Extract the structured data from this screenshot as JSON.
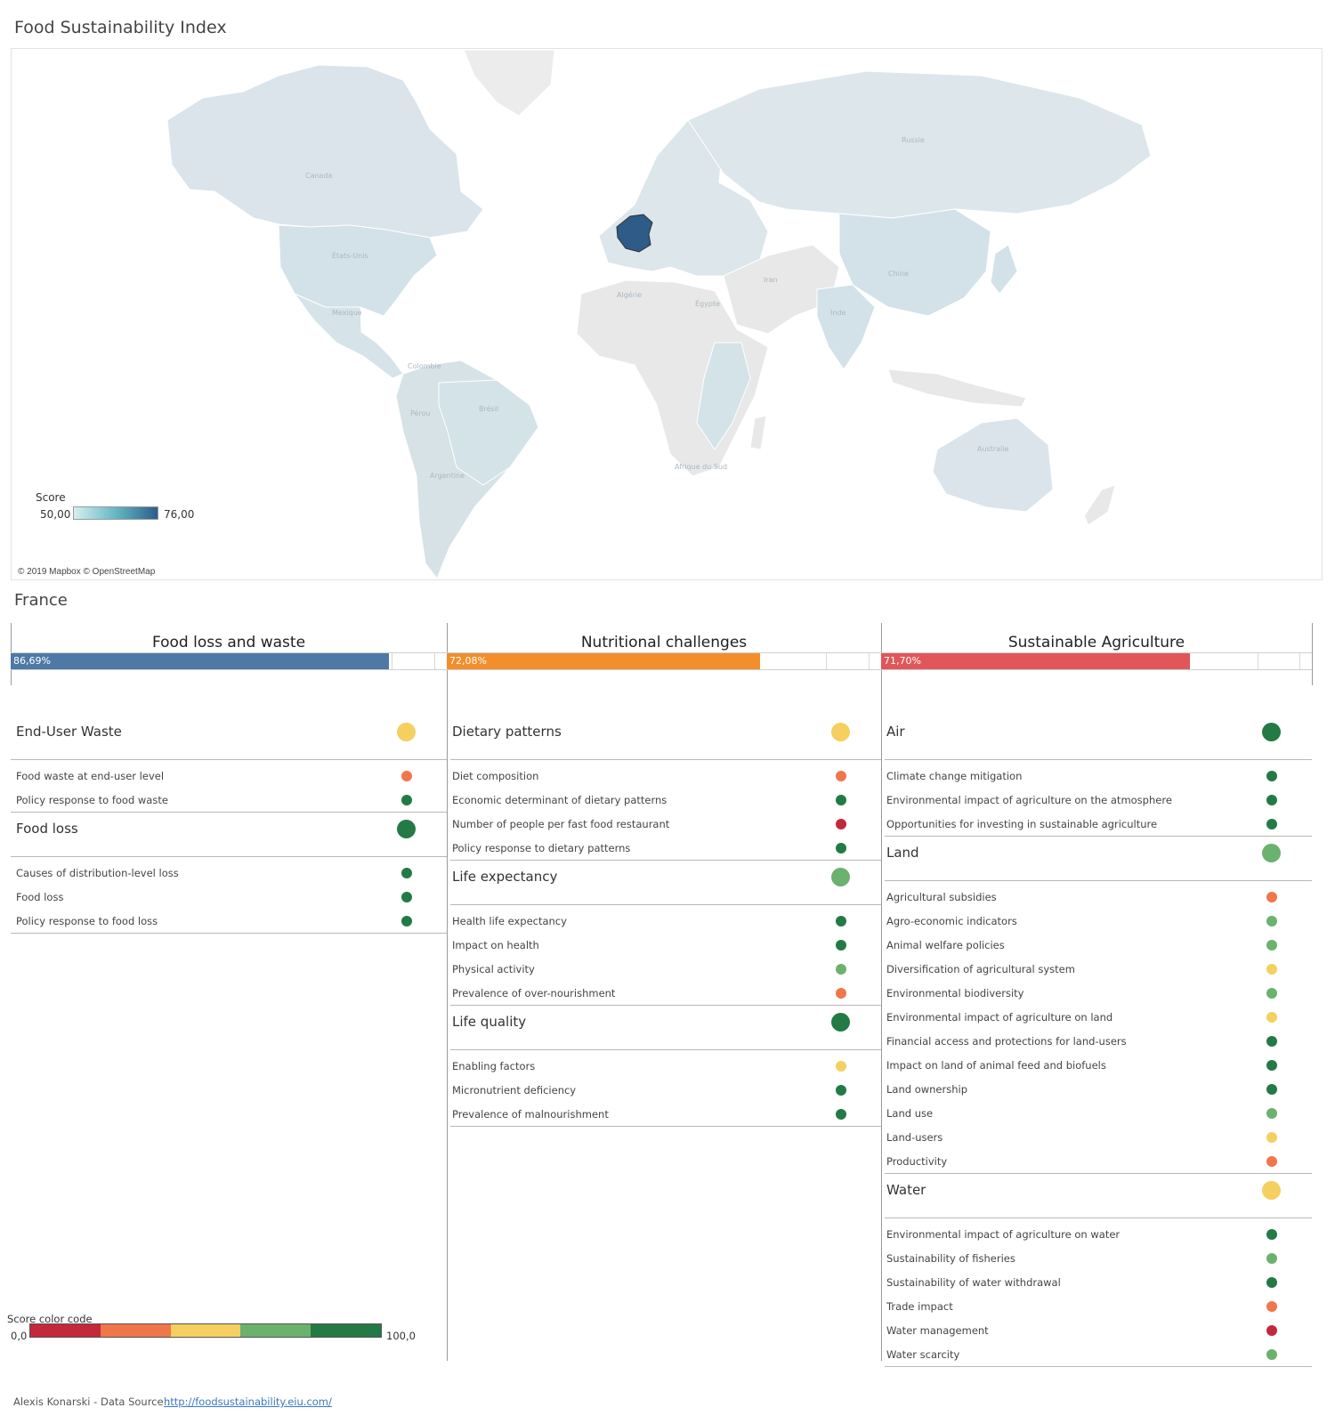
{
  "page": {
    "title": "Food Sustainability Index",
    "country": "France"
  },
  "map": {
    "legend": {
      "title": "Score",
      "min": "50,00",
      "max": "76,00"
    },
    "labels": {
      "canada": "Canada",
      "usa": "États-Unis",
      "mexico": "Mexique",
      "colombia": "Colombie",
      "peru": "Pérou",
      "brazil": "Brésil",
      "argentina": "Argentine",
      "algeria": "Algérie",
      "egypt": "Égypte",
      "south_africa": "Afrique du Sud",
      "russia": "Russie",
      "iran": "Iran",
      "china": "Chine",
      "india": "Inde",
      "australia": "Australie"
    },
    "credit": "© 2019 Mapbox © OpenStreetMap",
    "colors": {
      "highlight": "#2e5b87",
      "high_score": "#d3e3e8",
      "low_score": "#e0e6ea",
      "no_data": "#ececec"
    }
  },
  "score_colors": {
    "very_low": "#c4283b",
    "low": "#f0774a",
    "medium": "#f5cf60",
    "high": "#6ab26d",
    "very_high": "#237a44"
  },
  "pillars": [
    {
      "title": "Food loss and waste",
      "score_label": "86,69%",
      "score": 86.69,
      "bar_color": "#4e79a7",
      "categories": [
        {
          "name": "End-User Waste",
          "rating": "medium",
          "items": [
            {
              "name": "Food waste at end-user level",
              "rating": "low"
            },
            {
              "name": "Policy response to food waste",
              "rating": "very_high"
            }
          ]
        },
        {
          "name": "Food loss",
          "rating": "very_high",
          "items": [
            {
              "name": "Causes of distribution-level loss",
              "rating": "very_high"
            },
            {
              "name": "Food loss",
              "rating": "very_high"
            },
            {
              "name": "Policy response to food loss",
              "rating": "very_high"
            }
          ]
        }
      ]
    },
    {
      "title": "Nutritional challenges",
      "score_label": "72,08%",
      "score": 72.08,
      "bar_color": "#f28e2b",
      "categories": [
        {
          "name": "Dietary patterns",
          "rating": "medium",
          "items": [
            {
              "name": "Diet composition",
              "rating": "low"
            },
            {
              "name": "Economic determinant of dietary patterns",
              "rating": "very_high"
            },
            {
              "name": "Number of people per fast food restaurant",
              "rating": "very_low"
            },
            {
              "name": "Policy response to dietary patterns",
              "rating": "very_high"
            }
          ]
        },
        {
          "name": "Life expectancy",
          "rating": "high",
          "items": [
            {
              "name": "Health life expectancy",
              "rating": "very_high"
            },
            {
              "name": "Impact on health",
              "rating": "very_high"
            },
            {
              "name": "Physical activity",
              "rating": "high"
            },
            {
              "name": "Prevalence of over-nourishment",
              "rating": "low"
            }
          ]
        },
        {
          "name": "Life quality",
          "rating": "very_high",
          "items": [
            {
              "name": "Enabling factors",
              "rating": "medium"
            },
            {
              "name": "Micronutrient deficiency",
              "rating": "very_high"
            },
            {
              "name": "Prevalence of malnourishment",
              "rating": "very_high"
            }
          ]
        }
      ]
    },
    {
      "title": "Sustainable Agriculture",
      "score_label": "71,70%",
      "score": 71.7,
      "bar_color": "#e15759",
      "categories": [
        {
          "name": "Air",
          "rating": "very_high",
          "items": [
            {
              "name": "Climate change mitigation",
              "rating": "very_high"
            },
            {
              "name": "Environmental impact of agriculture on the atmosphere",
              "rating": "very_high"
            },
            {
              "name": "Opportunities for investing in sustainable agriculture",
              "rating": "very_high"
            }
          ]
        },
        {
          "name": "Land",
          "rating": "high",
          "items": [
            {
              "name": "Agricultural subsidies",
              "rating": "low"
            },
            {
              "name": "Agro-economic indicators",
              "rating": "high"
            },
            {
              "name": "Animal welfare policies",
              "rating": "high"
            },
            {
              "name": "Diversification of agricultural system",
              "rating": "medium"
            },
            {
              "name": "Environmental biodiversity",
              "rating": "high"
            },
            {
              "name": "Environmental impact of agriculture on land",
              "rating": "medium"
            },
            {
              "name": "Financial access and protections for land-users",
              "rating": "very_high"
            },
            {
              "name": "Impact on land of animal feed and biofuels",
              "rating": "very_high"
            },
            {
              "name": "Land ownership",
              "rating": "very_high"
            },
            {
              "name": "Land use",
              "rating": "high"
            },
            {
              "name": "Land-users",
              "rating": "medium"
            },
            {
              "name": "Productivity",
              "rating": "low"
            }
          ]
        },
        {
          "name": "Water",
          "rating": "medium",
          "items": [
            {
              "name": "Environmental impact of agriculture on water",
              "rating": "very_high"
            },
            {
              "name": "Sustainability of fisheries",
              "rating": "high"
            },
            {
              "name": "Sustainability of water withdrawal",
              "rating": "very_high"
            },
            {
              "name": "Trade impact",
              "rating": "low"
            },
            {
              "name": "Water management",
              "rating": "very_low"
            },
            {
              "name": "Water scarcity",
              "rating": "high"
            }
          ]
        }
      ]
    }
  ],
  "color_scale": {
    "title": "Score color code",
    "min": "0,0",
    "max": "100,0"
  },
  "footer": {
    "author": "Alexis Konarski - Data Source :",
    "link": "http://foodsustainability.eiu.com/"
  }
}
